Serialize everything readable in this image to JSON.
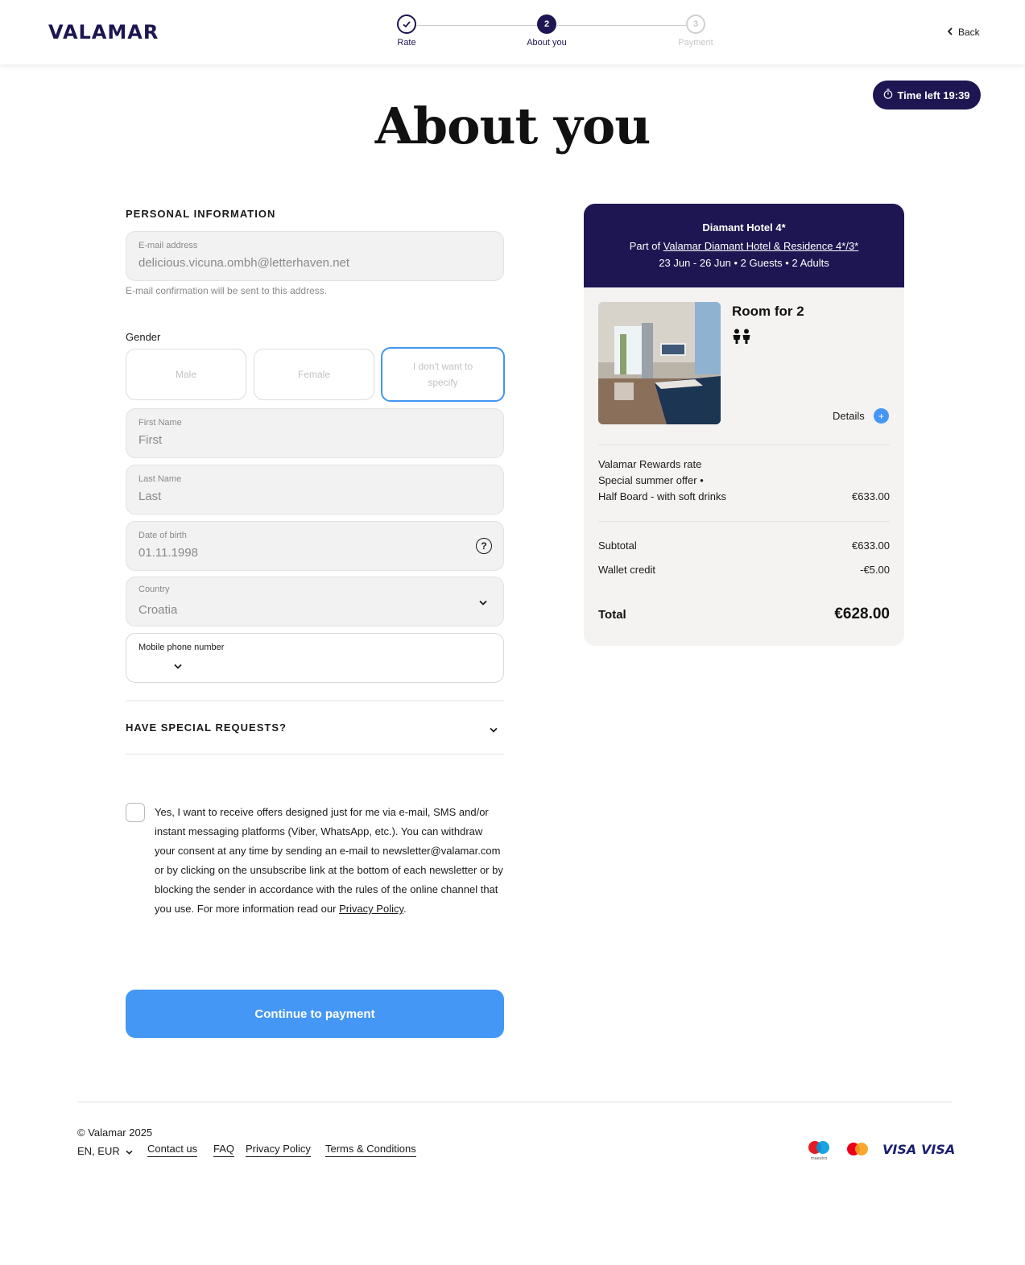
{
  "header": {
    "logo": "VALAMAR",
    "steps": [
      {
        "number": "",
        "label": "Rate",
        "state": "done"
      },
      {
        "number": "2",
        "label": "About you",
        "state": "active"
      },
      {
        "number": "3",
        "label": "Payment",
        "state": "future"
      }
    ],
    "back_label": "Back"
  },
  "timer": {
    "label": "Time left 19:39"
  },
  "page_title": "About you",
  "form": {
    "section_title": "PERSONAL INFORMATION",
    "email": {
      "label": "E-mail address",
      "value": "delicious.vicuna.ombh@letterhaven.net"
    },
    "email_hint": "E-mail confirmation will be sent to this address.",
    "gender_label": "Gender",
    "gender_options": [
      "Male",
      "Female",
      "I don't want to specify"
    ],
    "gender_selected": "I don't want to specify",
    "first_name": {
      "label": "First Name",
      "placeholder": "First"
    },
    "last_name": {
      "label": "Last Name",
      "placeholder": "Last"
    },
    "dob": {
      "label": "Date of birth",
      "placeholder": "01.11.1998"
    },
    "country": {
      "label": "Country",
      "value": "Croatia"
    },
    "phone": {
      "label": "Mobile phone number",
      "value": ""
    },
    "special_requests": "HAVE SPECIAL REQUESTS?",
    "consent_text": "Yes, I want to receive offers designed just for me via e-mail, SMS and/or instant messaging platforms (Viber, WhatsApp, etc.). You can withdraw your consent at any time by sending an e-mail to newsletter@valamar.com or by clicking on the unsubscribe link at the bottom of each newsletter or by blocking the sender in accordance with the rules of the online channel that you use. For more information read our ",
    "consent_link": "Privacy Policy",
    "consent_end": ".",
    "cta": "Continue to payment"
  },
  "summary": {
    "hotel_name": "Diamant Hotel 4*",
    "part_of_prefix": "Part of ",
    "part_of_link": "Valamar Diamant Hotel & Residence 4*/3*",
    "stay": "23 Jun - 26 Jun  •  2 Guests • 2 Adults",
    "room_title": "Room for 2",
    "details_label": "Details",
    "rate_lines": [
      "Valamar Rewards rate",
      "Special summer offer  •",
      "Half Board - with soft drinks"
    ],
    "rate_price": "€633.00",
    "subtotal_label": "Subtotal",
    "subtotal_value": "€633.00",
    "wallet_label": "Wallet credit",
    "wallet_value": "-€5.00",
    "total_label": "Total",
    "total_value": "€628.00"
  },
  "footer": {
    "copyright": "© Valamar 2025",
    "lang": "EN, EUR",
    "links": [
      "Contact us",
      "FAQ",
      "Privacy Policy",
      "Terms & Conditions"
    ],
    "payments": [
      "maestro",
      "mastercard",
      "VISA",
      "VISA"
    ]
  },
  "colors": {
    "brand": "#1d1652",
    "accent": "#4597f5"
  }
}
